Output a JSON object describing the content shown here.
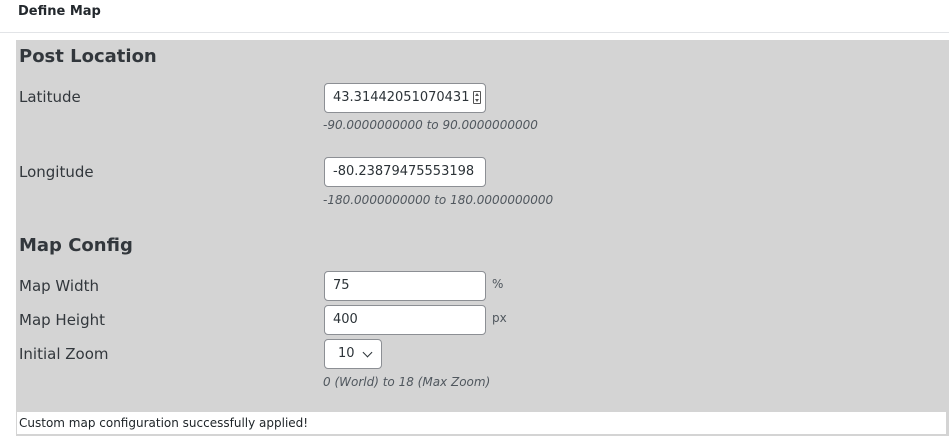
{
  "header": {
    "title": "Define Map"
  },
  "post_location": {
    "title": "Post Location",
    "latitude": {
      "label": "Latitude",
      "value": "43.31442051070431",
      "hint": "-90.0000000000 to 90.0000000000"
    },
    "longitude": {
      "label": "Longitude",
      "value": "-80.23879475553198",
      "hint": "-180.0000000000 to 180.0000000000"
    }
  },
  "map_config": {
    "title": "Map Config",
    "width": {
      "label": "Map Width",
      "value": "75",
      "unit": "%"
    },
    "height": {
      "label": "Map Height",
      "value": "400",
      "unit": "px"
    },
    "zoom": {
      "label": "Initial Zoom",
      "value": "10",
      "hint": "0 (World) to 18 (Max Zoom)"
    }
  },
  "notice": {
    "text": "Custom map configuration successfully applied!"
  },
  "icons": {
    "latitude_spinner": "spinner-icon",
    "zoom_dropdown": "chevron-down-icon"
  },
  "colors": {
    "panel_background": "#d4d4d4",
    "input_border": "#8c8f94"
  }
}
